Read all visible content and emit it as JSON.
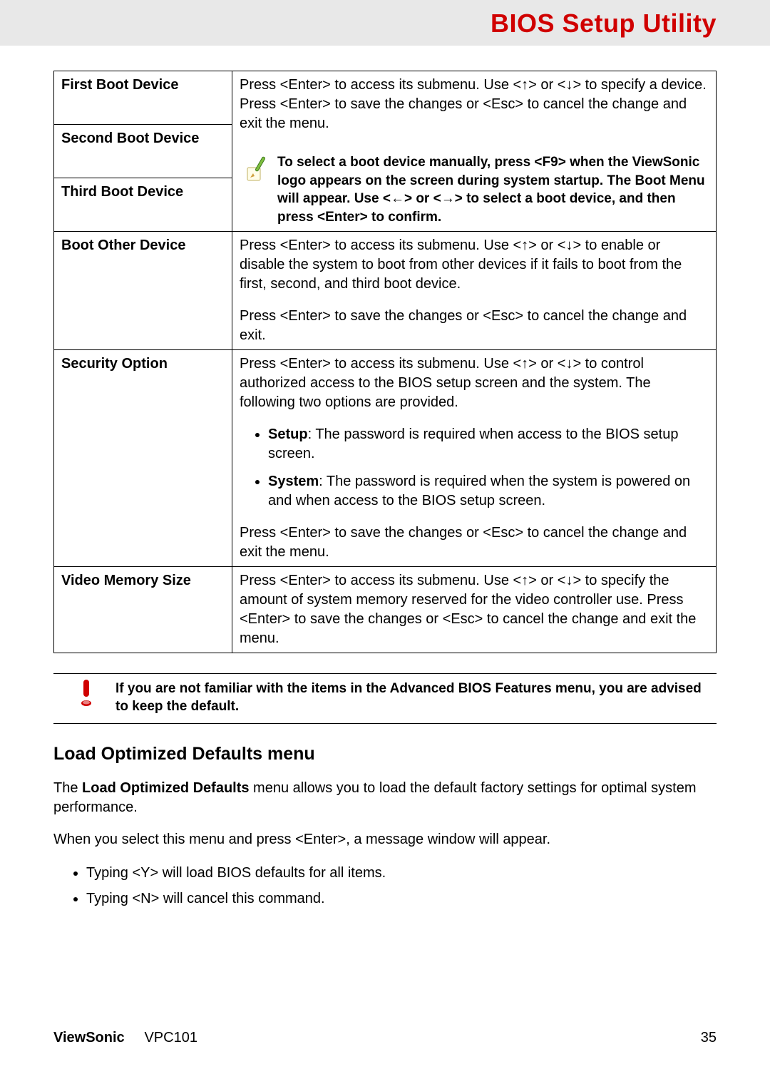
{
  "header": {
    "title": "BIOS Setup Utility"
  },
  "table": {
    "rows": {
      "first_boot": {
        "label": "First Boot Device"
      },
      "second_boot": {
        "label": "Second Boot Device"
      },
      "third_boot": {
        "label": "Third Boot Device"
      },
      "boot_desc_p1": "Press <Enter> to access its submenu. Use <↑> or <↓> to specify a device. Press <Enter> to save the changes or <Esc> to cancel the change and exit the menu.",
      "tip_text": "To select a boot device manually, press <F9> when the ViewSonic logo appears on the screen during system startup. The Boot Menu will appear. Use <←> or <→> to select a boot device, and then press <Enter> to confirm.",
      "boot_other": {
        "label": "Boot Other Device",
        "p1": "Press <Enter> to access its submenu. Use <↑> or <↓> to enable or disable the system to boot from other devices if it fails to boot from the first, second, and third boot device.",
        "p2": "Press <Enter> to save the changes or <Esc> to cancel the change and exit."
      },
      "security": {
        "label": "Security Option",
        "p1": "Press <Enter> to access its submenu. Use <↑> or <↓> to control authorized access to the BIOS setup screen and the system. The following two options are provided.",
        "opt1_name": "Setup",
        "opt1_text": ": The password is required when access to the BIOS setup screen.",
        "opt2_name": "System",
        "opt2_text": ": The password is required when the system is powered on and when access to the BIOS setup screen.",
        "p2": "Press <Enter> to save the changes or <Esc> to cancel the change and exit the menu."
      },
      "video_mem": {
        "label": "Video Memory Size",
        "p1": "Press <Enter> to access its submenu. Use <↑> or <↓> to specify the amount of system memory reserved for the video controller use. Press <Enter> to save the changes or <Esc> to cancel the change and exit the menu."
      }
    }
  },
  "warning": "If you are not familiar with the items in the Advanced BIOS Features menu, you are advised to keep the default.",
  "section2": {
    "heading": "Load Optimized Defaults menu",
    "p1_a": "The ",
    "p1_strong": "Load Optimized Defaults",
    "p1_b": " menu allows you to load the default factory settings for optimal system performance.",
    "p2": "When you select this menu and press <Enter>, a message window will appear.",
    "li1": "Typing <Y> will load BIOS defaults for all items.",
    "li2": "Typing <N> will cancel this command."
  },
  "footer": {
    "brand": "ViewSonic",
    "model": "VPC101",
    "page": "35"
  }
}
